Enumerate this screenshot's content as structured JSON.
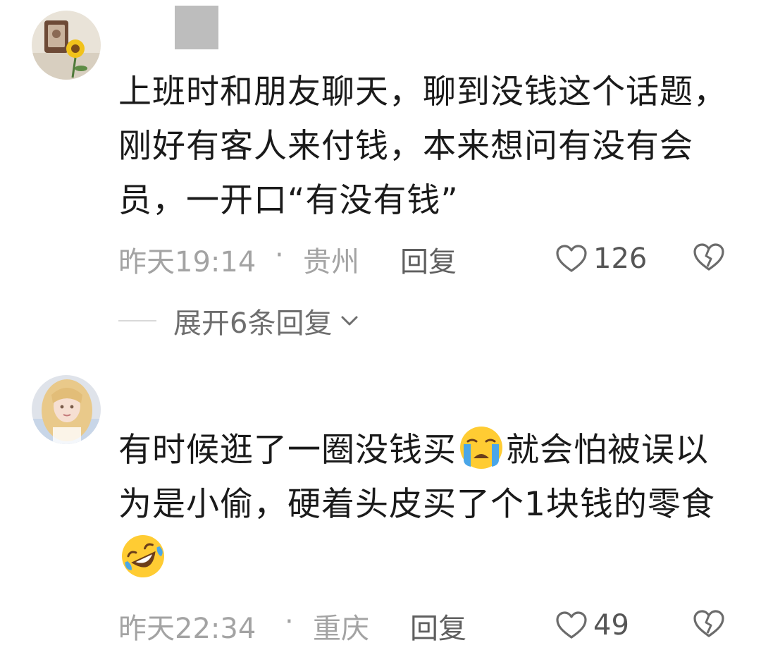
{
  "comments": [
    {
      "text_parts": [
        "上班时和朋友聊天，聊到没钱这个话题，刚好有客人来付钱，本来想问有没有会员，一开口“有没有钱”"
      ],
      "time": "昨天19:14",
      "dot": "·",
      "location": "贵州",
      "reply_label": "回复",
      "likes": "126",
      "expand_label": "展开6条回复"
    },
    {
      "text_parts": [
        "有时候逛了一圈没钱买",
        "就会怕被误以为是小偷，硬着头皮买了个1块钱的零食"
      ],
      "emojis": [
        "loudly-crying-face",
        "rolling-on-floor-laughing"
      ],
      "time": "昨天22:34",
      "dot": "·",
      "location": "重庆",
      "reply_label": "回复",
      "likes": "49"
    }
  ],
  "colors": {
    "meta_gray": "#a3a3a3",
    "reply_gray": "#5f5f5f",
    "text": "#1a1a1a",
    "emoji_yellow": "#ffcc33",
    "tear_blue": "#4aa6e8"
  }
}
